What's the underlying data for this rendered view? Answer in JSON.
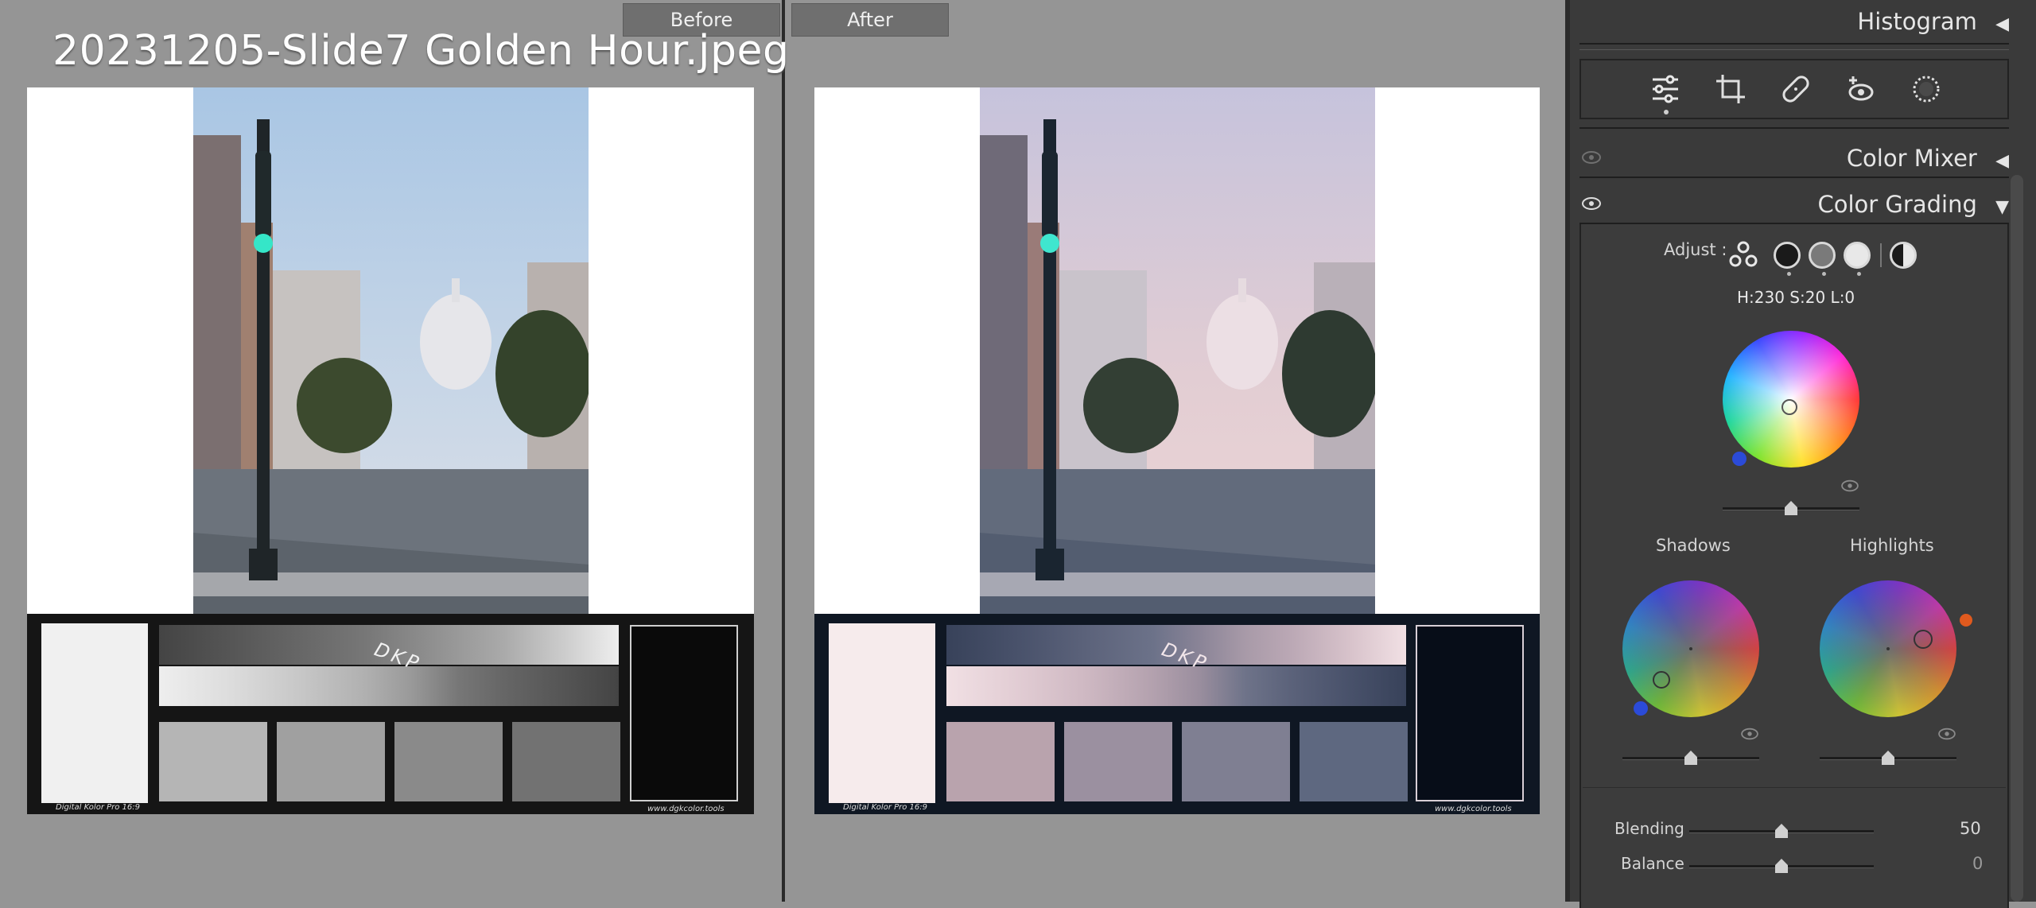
{
  "view": {
    "before_label": "Before",
    "after_label": "After",
    "filename": "20231205-Slide7 Golden Hour.jpeg"
  },
  "card": {
    "brand": "Digital Kolor Pro 16:9",
    "url": "www.dgkcolor.tools",
    "logo": "DKP"
  },
  "panel": {
    "histogram": {
      "label": "Histogram",
      "icon": "triangle-left-icon"
    },
    "tools": [
      "edit-sliders-icon",
      "crop-icon",
      "healing-bandage-icon",
      "red-eye-icon",
      "masking-icon"
    ],
    "color_mixer": {
      "label": "Color Mixer",
      "icon": "triangle-left-icon"
    },
    "color_grading": {
      "label": "Color Grading",
      "icon": "triangle-down-icon",
      "adjust_label": "Adjust :",
      "readout": "H:230 S:20 L:0",
      "shadows_label": "Shadows",
      "highlights_label": "Highlights",
      "blending_label": "Blending",
      "blending_value": "50",
      "balance_label": "Balance",
      "balance_value": "0"
    }
  },
  "colors": {
    "panel_bg": "#3a3a3a",
    "canvas_bg": "#959595",
    "accent_blue": "#2b4bd8",
    "accent_orange": "#e05a1e"
  }
}
